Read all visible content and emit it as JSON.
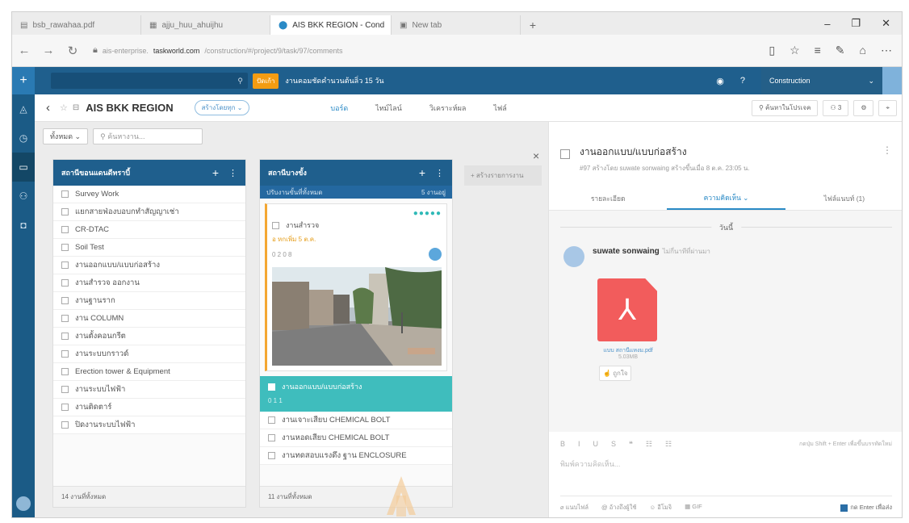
{
  "browser": {
    "tabs": [
      {
        "label": "bsb_rawahaa.pdf"
      },
      {
        "label": "ajju_huu_ahuijhu"
      },
      {
        "label": "AIS BKK REGION - Cond",
        "close": "×"
      },
      {
        "label": "New tab"
      }
    ],
    "new_tab": "+",
    "window_controls": {
      "minimize": "–",
      "maximize": "❐",
      "close": "✕"
    },
    "url_host": "taskworld.com",
    "url_pre": "ais-enterprise.",
    "url_path": "/construction/#/project/9/task/97/comments"
  },
  "app": {
    "search_badge": "ปัดเก้า",
    "notice": "งานคอมชัดคำนวนต้นลิ่ว 15 วัน",
    "workspace": "Construction",
    "ws_caret": "⌄"
  },
  "project": {
    "title": "AIS BKK REGION",
    "pill": "สร้างโดยทุก ⌄",
    "views": [
      "บอร์ด",
      "ไทม์ไลน์",
      "วิเคราะห์ผล",
      "ไฟล์"
    ],
    "search_btn": "ค้นหาในโปรเจค",
    "members": "3",
    "settings_icon": "⚙",
    "pin_icon": "⌖"
  },
  "board": {
    "filter_select": "ทั้งหมด ⌄",
    "filter_search": "ค้นหางาน...",
    "list1": {
      "title": "สถานีขอนแดนดีทราบี้",
      "items": [
        "Survey Work",
        "แยกสายฟ่องบอบกทำสัญญาเช่า",
        "CR-DTAC",
        "Soil Test",
        "งานออกแบบ/แบบก่อสร้าง",
        "งานสำรวจ ออกงาน",
        "งานฐานราก",
        "งาน COLUMN",
        "งานตั้งคอนกรีต",
        "งานระบบกราวด์",
        "Erection tower & Equipment",
        "งานระบบไฟฟ้า",
        "งานติดตาร์",
        "ปิดงานระบบไฟฟ้า"
      ],
      "footer": "14 งานที่ทั้งหมด"
    },
    "list2": {
      "title": "สถานีบางขั้ง",
      "subtitle": "ปรับงานขั้นที่ทั้งหมด",
      "sub_right": "5 งานอยู่",
      "card": {
        "dots": "●●●●●",
        "title": "งานสำรวจ",
        "due": "อ หกเพิ่ม 5 ต.ค.",
        "meta": "0 2  0 8"
      },
      "highlight": {
        "title": "งานออกแบบ/แบบก่อสร้าง",
        "meta": "0 1   1"
      },
      "items": [
        "งานเจาะเสียบ CHEMICAL BOLT",
        "งานหอดเสียบ CHEMICAL BOLT",
        "งานทดสอบแรงดึง ฐาน ENCLOSURE"
      ],
      "footer": "11 งานที่ทั้งหมด"
    },
    "add_list": "+ สร้างรายการงาน"
  },
  "detail": {
    "close": "×",
    "title": "งานออกแบบ/แบบก่อสร้าง",
    "subtitle": "#97 สร้างโดย suwate sonwaing สร้างขึ้นเมื่อ 8 ต.ค. 23:05 น.",
    "tabs": [
      "รายละเอียด",
      "ความคิดเห็น ⌄",
      "ไฟล์แนบท์ (1)"
    ],
    "date_label": "วันนี้",
    "commenter": "suwate sonwaing",
    "comment_time": "ไม่กี่นาทีที่ผ่านมา",
    "pdf_name": "แบบ สถานีแหงม.pdf",
    "pdf_size": "5.03MB",
    "like": "ถูกใจ",
    "editor_tools": [
      "B",
      "I",
      "U",
      "S",
      "❝",
      "☷",
      "☷"
    ],
    "editor_hint": "กดปุ่ม Shift + Enter เพื่อขึ้นบรรทัดใหม่",
    "editor_placeholder": "พิมพ์ความคิดเห็น...",
    "editor_footer": [
      "แนบไฟล์",
      "อ้างถึงผู้ใช้",
      "อีโมจิ",
      "GIF"
    ],
    "send_toggle": "กด Enter เพื่อส่ง"
  }
}
